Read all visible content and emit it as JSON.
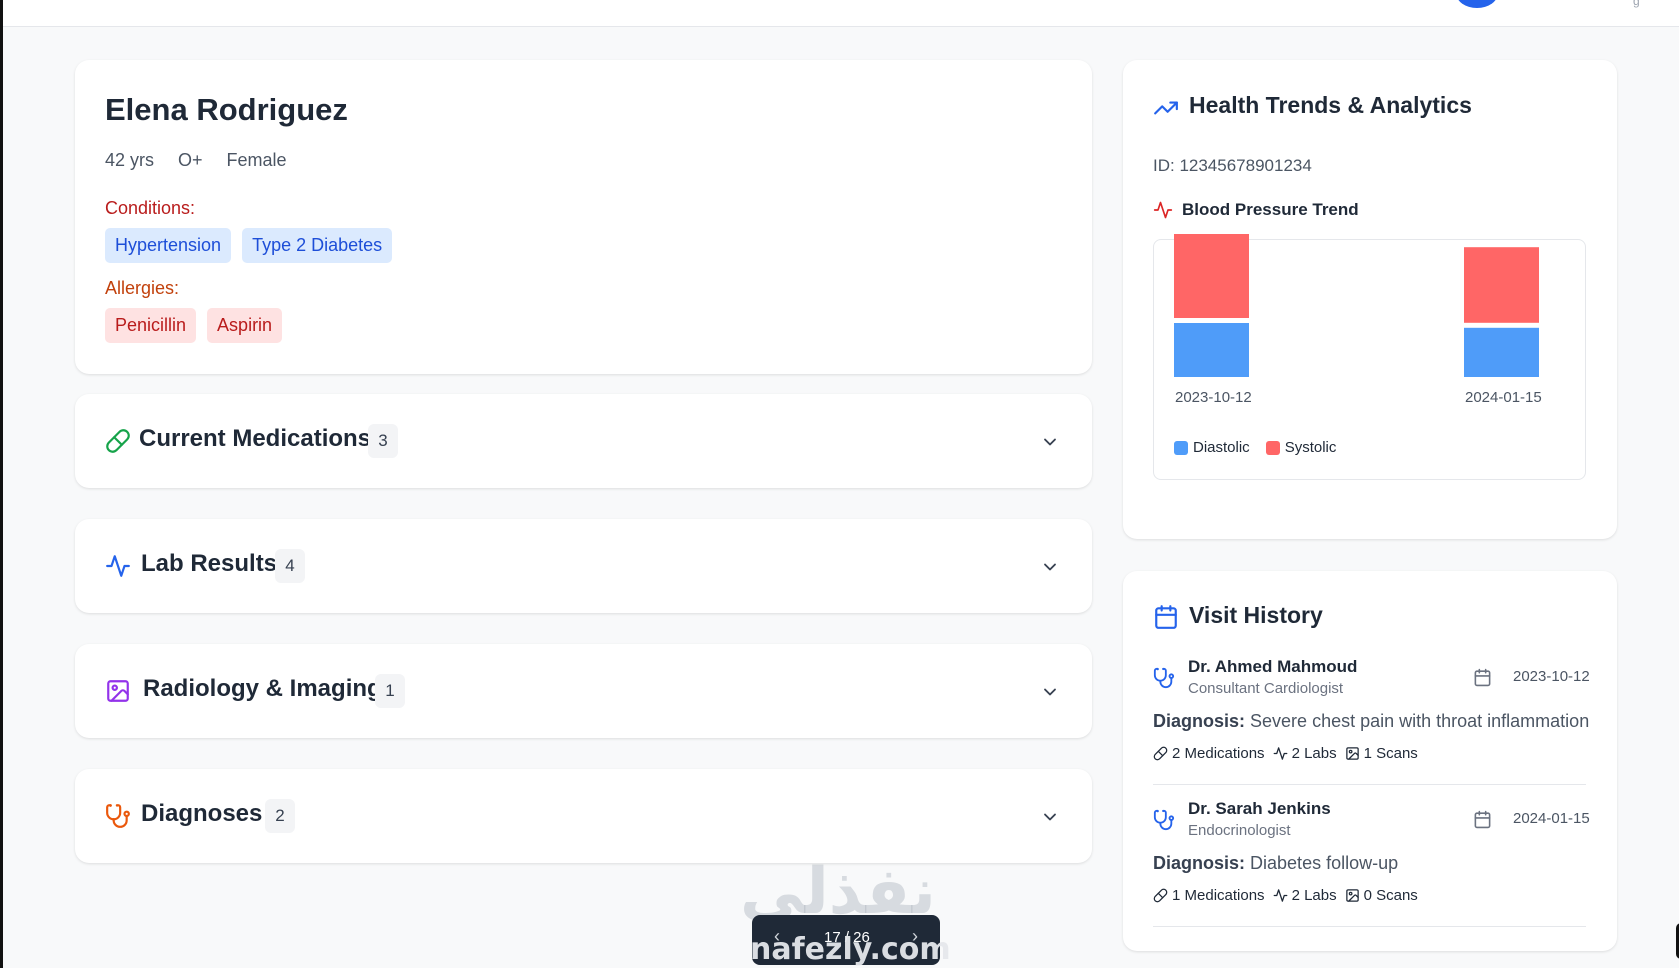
{
  "top_bar": {
    "corner_text": "g"
  },
  "patient": {
    "name": "Elena Rodriguez",
    "age": "42 yrs",
    "blood_type": "O+",
    "gender": "Female",
    "conditions_label": "Conditions:",
    "conditions": [
      "Hypertension",
      "Type 2 Diabetes"
    ],
    "allergies_label": "Allergies:",
    "allergies": [
      "Penicillin",
      "Aspirin"
    ]
  },
  "sections": [
    {
      "title": "Current Medications",
      "count": "3",
      "icon": "pill-icon",
      "color": "#16a34a"
    },
    {
      "title": "Lab Results",
      "count": "4",
      "icon": "activity-icon",
      "color": "#2563eb"
    },
    {
      "title": "Radiology & Imaging",
      "count": "1",
      "icon": "image-icon",
      "color": "#9333ea"
    },
    {
      "title": "Diagnoses",
      "count": "2",
      "icon": "stethoscope-icon",
      "color": "#ea580c"
    }
  ],
  "trends": {
    "title": "Health Trends & Analytics",
    "patient_id": "ID: 12345678901234",
    "bp_title": "Blood Pressure Trend",
    "legend": {
      "diastolic": "Diastolic",
      "systolic": "Systolic"
    }
  },
  "chart_data": {
    "type": "bar",
    "stacked": true,
    "categories": [
      "2023-10-12",
      "2024-01-15"
    ],
    "series": [
      {
        "name": "Diastolic",
        "color": "#4f9cf9",
        "values": [
          90,
          82
        ]
      },
      {
        "name": "Systolic",
        "color": "#ff6666",
        "values": [
          140,
          126
        ]
      }
    ],
    "legend_position": "bottom-left",
    "grid": false
  },
  "visits": {
    "title": "Visit History",
    "diagnosis_label": "Diagnosis:",
    "items": [
      {
        "doctor": "Dr. Ahmed Mahmoud",
        "role": "Consultant Cardiologist",
        "date": "2023-10-12",
        "diagnosis": "Severe chest pain with throat inflammation",
        "medications": "2 Medications",
        "labs": "2 Labs",
        "scans": "1 Scans"
      },
      {
        "doctor": "Dr. Sarah Jenkins",
        "role": "Endocrinologist",
        "date": "2024-01-15",
        "diagnosis": "Diabetes follow-up",
        "medications": "1 Medications",
        "labs": "2 Labs",
        "scans": "0 Scans"
      }
    ]
  },
  "pager": {
    "counter": "17 / 26",
    "prev": "‹",
    "next": "›"
  },
  "watermark": {
    "arabic": "نفذلي",
    "latin": "nafezly.com"
  },
  "colors": {
    "primary": "#2563eb",
    "danger": "#b91c1c",
    "warning": "#c2410c"
  }
}
